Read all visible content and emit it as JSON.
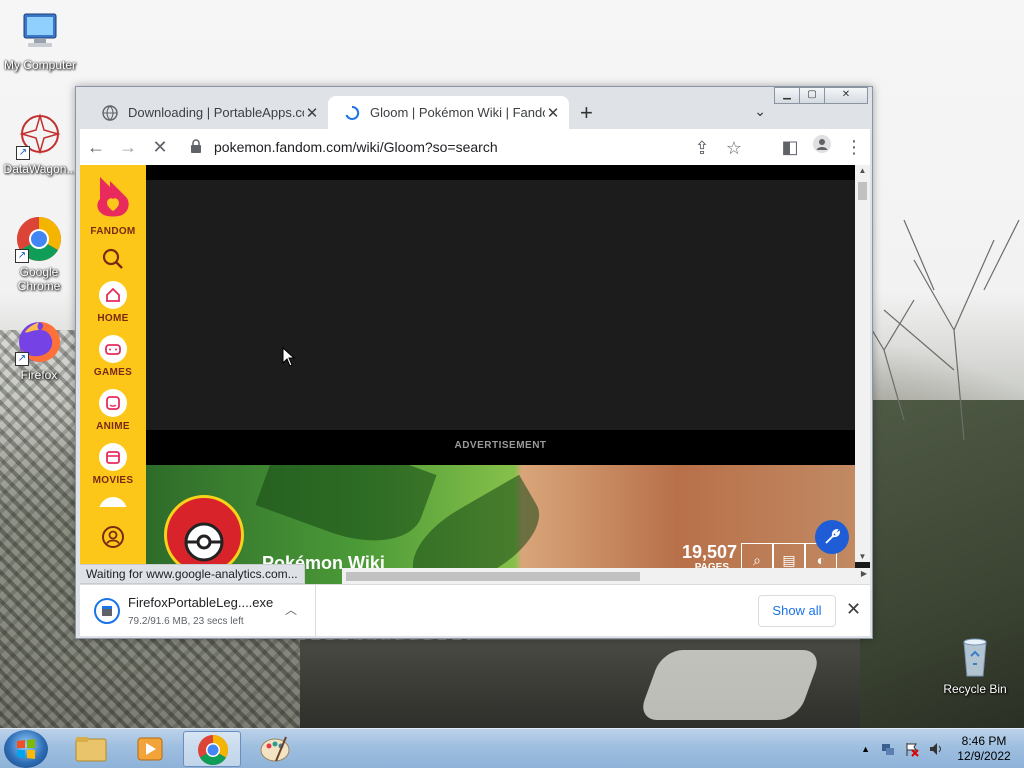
{
  "desktop": {
    "icons": [
      {
        "label": "My Computer"
      },
      {
        "label": "DataWagon..."
      },
      {
        "label": "Google Chrome"
      },
      {
        "label": "Firefox"
      },
      {
        "label": "Recycle Bin"
      }
    ]
  },
  "browser": {
    "tabs": [
      {
        "title": "Downloading | PortableApps.com",
        "active": false
      },
      {
        "title": "Gloom | Pokémon Wiki | Fandom",
        "active": true
      }
    ],
    "new_tab": "+",
    "url": "pokemon.fandom.com/wiki/Gloom?so=search",
    "status_text": "Waiting for www.google-analytics.com..."
  },
  "page": {
    "nav": {
      "logo_label": "FANDOM",
      "items": [
        {
          "label": "HOME"
        },
        {
          "label": "GAMES"
        },
        {
          "label": "ANIME"
        },
        {
          "label": "MOVIES"
        }
      ]
    },
    "ad_label": "ADVERTISEMENT",
    "hero": {
      "title": "Pokémon Wiki",
      "count": "19,507",
      "count_label": "PAGES"
    }
  },
  "download": {
    "filename": "FirefoxPortableLeg....exe",
    "status": "79.2/91.6 MB, 23 secs left",
    "show_all": "Show all"
  },
  "taskbar": {
    "time": "8:46 PM",
    "date": "12/9/2022"
  },
  "colors": {
    "fandom_yellow": "#fdc719",
    "fandom_red": "#7a2a13",
    "chrome_blue": "#1a73e8"
  }
}
